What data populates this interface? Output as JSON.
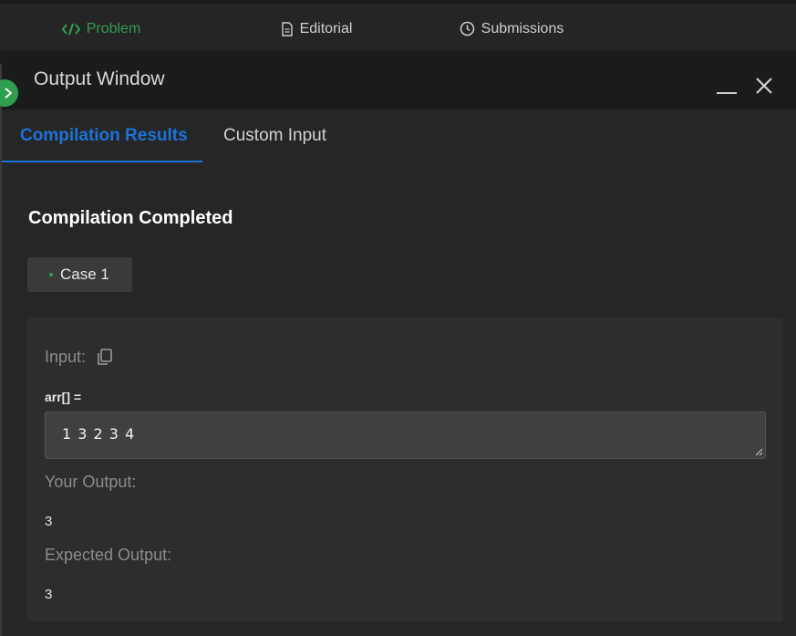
{
  "top_tabs": [
    {
      "label": "Problem",
      "icon": "code-icon",
      "active": true
    },
    {
      "label": "Editorial",
      "icon": "document-icon",
      "active": false
    },
    {
      "label": "Submissions",
      "icon": "clock-icon",
      "active": false
    }
  ],
  "output_window": {
    "title": "Output Window",
    "tabs": [
      {
        "label": "Compilation Results",
        "active": true
      },
      {
        "label": "Custom Input",
        "active": false
      }
    ],
    "status": "Compilation Completed",
    "case_label": "Case 1",
    "input_label": "Input:",
    "variable_name": "arr[] =",
    "input_value": "1 3 2 3 4",
    "your_output_label": "Your Output:",
    "your_output_value": "3",
    "expected_output_label": "Expected Output:",
    "expected_output_value": "3"
  },
  "colors": {
    "accent_green": "#2f9e4f",
    "accent_blue": "#1a73d9"
  }
}
